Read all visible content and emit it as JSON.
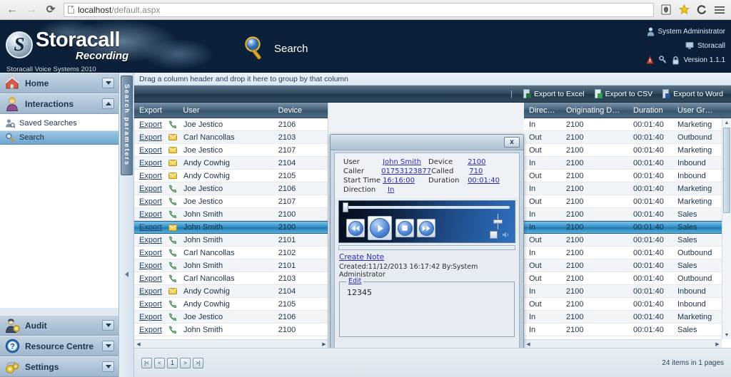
{
  "browser": {
    "back_icon": "back-arrow-icon",
    "forward_icon": "forward-arrow-icon",
    "reload_icon": "reload-icon",
    "url_host": "localhost",
    "url_path": "/default.aspx",
    "shield_icon": "shield-icon",
    "star_icon": "bookmark-star-icon",
    "profile_icon": "profile-icon",
    "menu_icon": "hamburger-menu-icon"
  },
  "header": {
    "logo_mark": "S",
    "logo_word": "Storacall",
    "logo_sub": "Recording",
    "logo_tagline": "Storacall Voice Systems 2010",
    "page_title": "Search",
    "page_title_icon": "magnifier-icon",
    "user_name": "System Administrator",
    "company": "Storacall",
    "version": "Version 1.1.1",
    "user_icon": "user-icon",
    "company_icon": "monitor-icon",
    "alert_icon": "alert-icon",
    "key_icon": "key-icon",
    "lock_icon": "padlock-icon"
  },
  "sidebar": {
    "panels": [
      {
        "label": "Home",
        "icon": "house-icon",
        "state": "collapsed"
      },
      {
        "label": "Interactions",
        "icon": "person-icon",
        "state": "expanded"
      }
    ],
    "items": [
      {
        "label": "Saved Searches",
        "icon": "saved-search-icon",
        "selected": false
      },
      {
        "label": "Search",
        "icon": "magnifier-small-icon",
        "selected": true
      }
    ],
    "bottom_panels": [
      {
        "label": "Audit",
        "icon": "auditor-icon",
        "state": "collapsed"
      },
      {
        "label": "Resource Centre",
        "icon": "question-icon",
        "state": "collapsed"
      },
      {
        "label": "Settings",
        "icon": "gears-icon",
        "state": "collapsed"
      }
    ],
    "params_tab_label": "Search parameters"
  },
  "main": {
    "group_hint": "Drag a column header and drop it here to group by that column",
    "toolbar": {
      "separator": "|",
      "buttons": [
        {
          "label": "Export to Excel",
          "icon": "excel-doc-icon",
          "color": "#1e7145"
        },
        {
          "label": "Export to CSV",
          "icon": "csv-doc-icon",
          "color": "#2f9e52"
        },
        {
          "label": "Export to Word",
          "icon": "word-doc-icon",
          "color": "#2b579a"
        }
      ]
    },
    "grid": {
      "left_columns": [
        "Export",
        "",
        "User",
        "Device"
      ],
      "right_columns": [
        "Direction",
        "Originating Device",
        "Duration",
        "User Group"
      ],
      "export_label": "Export",
      "rows": [
        {
          "user": "Joe Jestico",
          "device": "2106",
          "icon": "phone-green-icon",
          "direction": "In",
          "orig": "2100",
          "duration": "00:01:40",
          "group": "Marketing",
          "selected": false
        },
        {
          "user": "Carl Nancollas",
          "device": "2103",
          "icon": "voicemail-gold-icon",
          "direction": "Out",
          "orig": "2100",
          "duration": "00:01:40",
          "group": "Outbound",
          "selected": false
        },
        {
          "user": "Joe Jestico",
          "device": "2107",
          "icon": "voicemail-gold-icon",
          "direction": "Out",
          "orig": "2100",
          "duration": "00:01:40",
          "group": "Marketing",
          "selected": false
        },
        {
          "user": "Andy Cowhig",
          "device": "2104",
          "icon": "voicemail-gold-icon",
          "direction": "In",
          "orig": "2100",
          "duration": "00:01:40",
          "group": "Inbound",
          "selected": false
        },
        {
          "user": "Andy Cowhig",
          "device": "2105",
          "icon": "voicemail-gold-icon",
          "direction": "Out",
          "orig": "2100",
          "duration": "00:01:40",
          "group": "Inbound",
          "selected": false
        },
        {
          "user": "Joe Jestico",
          "device": "2106",
          "icon": "phone-green-icon",
          "direction": "In",
          "orig": "2100",
          "duration": "00:01:40",
          "group": "Marketing",
          "selected": false
        },
        {
          "user": "Joe Jestico",
          "device": "2107",
          "icon": "phone-green-icon",
          "direction": "Out",
          "orig": "2100",
          "duration": "00:01:40",
          "group": "Marketing",
          "selected": false
        },
        {
          "user": "John Smith",
          "device": "2100",
          "icon": "phone-green-icon",
          "direction": "In",
          "orig": "2100",
          "duration": "00:01:40",
          "group": "Sales",
          "selected": false
        },
        {
          "user": "John Smith",
          "device": "2100",
          "icon": "voicemail-gold-icon",
          "direction": "In",
          "orig": "2100",
          "duration": "00:01:40",
          "group": "Sales",
          "selected": true
        },
        {
          "user": "John Smith",
          "device": "2101",
          "icon": "phone-green-icon",
          "direction": "Out",
          "orig": "2100",
          "duration": "00:01:40",
          "group": "Sales",
          "selected": false
        },
        {
          "user": "Carl Nancollas",
          "device": "2102",
          "icon": "phone-green-icon",
          "direction": "In",
          "orig": "2100",
          "duration": "00:01:40",
          "group": "Outbound",
          "selected": false
        },
        {
          "user": "John Smith",
          "device": "2101",
          "icon": "phone-green-icon",
          "direction": "Out",
          "orig": "2100",
          "duration": "00:01:40",
          "group": "Sales",
          "selected": false
        },
        {
          "user": "Carl Nancollas",
          "device": "2103",
          "icon": "phone-green-icon",
          "direction": "Out",
          "orig": "2100",
          "duration": "00:01:40",
          "group": "Outbound",
          "selected": false
        },
        {
          "user": "Andy Cowhig",
          "device": "2104",
          "icon": "voicemail-gold-icon",
          "direction": "In",
          "orig": "2100",
          "duration": "00:01:40",
          "group": "Inbound",
          "selected": false
        },
        {
          "user": "Andy Cowhig",
          "device": "2105",
          "icon": "phone-green-icon",
          "direction": "Out",
          "orig": "2100",
          "duration": "00:01:40",
          "group": "Inbound",
          "selected": false
        },
        {
          "user": "Joe Jestico",
          "device": "2106",
          "icon": "phone-green-icon",
          "direction": "In",
          "orig": "2100",
          "duration": "00:01:40",
          "group": "Marketing",
          "selected": false
        },
        {
          "user": "John Smith",
          "device": "2100",
          "icon": "phone-green-icon",
          "direction": "In",
          "orig": "2100",
          "duration": "00:01:40",
          "group": "Sales",
          "selected": false
        }
      ]
    },
    "pager": {
      "first": "|<",
      "prev": "<",
      "page": "1",
      "next": ">",
      "last": ">|",
      "status": "24 items in 1 pages"
    }
  },
  "modal": {
    "close_label": "x",
    "close_icon": "close-icon",
    "meta": [
      {
        "k": "User",
        "v": "John Smith",
        "k2": "Device",
        "v2": "2100"
      },
      {
        "k": "Caller",
        "v": "01753123877",
        "k2": "Called",
        "v2": "710"
      },
      {
        "k": "Start Time",
        "v": "16:16:00",
        "k2": "Duration",
        "v2": "00:01:40"
      },
      {
        "k": "Direction",
        "v": "In",
        "k2": "",
        "v2": ""
      }
    ],
    "player": {
      "rewind_icon": "rewind-icon",
      "play_icon": "play-icon",
      "stop_icon": "stop-icon",
      "forward_icon": "fast-forward-icon",
      "volume_icon": "speaker-icon",
      "mute_icon": "mute-checkbox-icon"
    },
    "create_note_label": "Create Note",
    "note_created": "Created:11/12/2013 16:17:42 By:System Administrator",
    "note_edit_label": "Edit",
    "note_text": "12345"
  }
}
